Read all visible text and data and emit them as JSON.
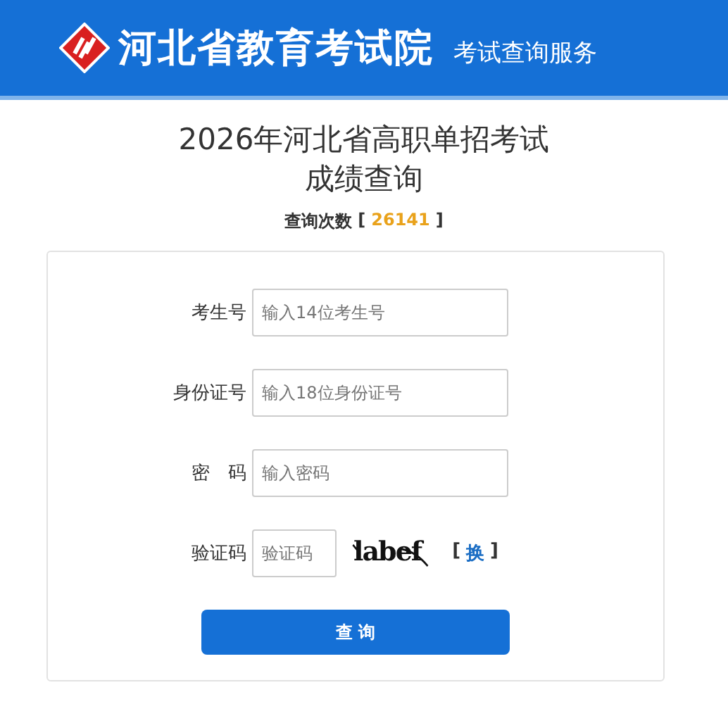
{
  "header": {
    "title": "河北省教育考试院",
    "subtitle": "考试查询服务"
  },
  "page_title": [
    "2026年河北省高职单招考试",
    "成绩查询"
  ],
  "query_count": {
    "label": "查询次数",
    "open": "[",
    "value": "26141",
    "close": "]"
  },
  "fields": [
    {
      "label": "考生号",
      "placeholder": "输入14位考生号",
      "kind": "text"
    },
    {
      "label": "身份证号",
      "placeholder": "输入18位身份证号",
      "kind": "text"
    },
    {
      "label": "密　码",
      "placeholder": "输入密码",
      "kind": "text"
    },
    {
      "label": "验证码",
      "placeholder": "验证码",
      "kind": "captcha",
      "captcha": "labef",
      "refresh_open": "[",
      "refresh": "换",
      "refresh_close": "]"
    }
  ],
  "submit": "查 询"
}
